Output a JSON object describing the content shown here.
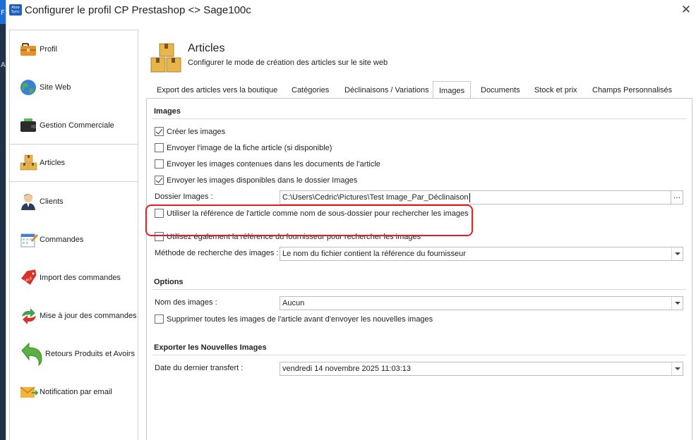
{
  "window": {
    "title": "Configurer le profil CP Prestashop <> Sage100c",
    "logo_text": "Atoo Sync",
    "close_icon": "close-icon"
  },
  "desktop": {
    "letters": [
      "F",
      "A"
    ]
  },
  "sidebar": {
    "items": [
      {
        "label": "Profil",
        "icon": "briefcase-icon"
      },
      {
        "label": "Site Web",
        "icon": "globe-icon"
      },
      {
        "label": "Gestion Commerciale",
        "icon": "wallet-icon"
      },
      {
        "label": "Articles",
        "icon": "boxes-icon",
        "active": true
      },
      {
        "label": "Clients",
        "icon": "user-icon"
      },
      {
        "label": "Commandes",
        "icon": "calendar-icon"
      },
      {
        "label": "Import des commandes",
        "icon": "sale-tag-icon"
      },
      {
        "label": "Mise à jour des commandes",
        "icon": "refresh-arrows-icon"
      },
      {
        "label": "Retours Produits et Avoirs",
        "icon": "return-arrow-icon"
      },
      {
        "label": "Notification par email",
        "icon": "email-icon"
      }
    ]
  },
  "header": {
    "title": "Articles",
    "subtitle": "Configurer le mode de création des articles sur le site web"
  },
  "tabs": [
    {
      "label": "Export des articles vers la boutique"
    },
    {
      "label": "Catégories"
    },
    {
      "label": "Déclinaisons / Variations"
    },
    {
      "label": "Images",
      "active": true
    },
    {
      "label": "Documents"
    },
    {
      "label": "Stock et prix"
    },
    {
      "label": "Champs Personnalisés"
    }
  ],
  "images_section": {
    "title": "Images",
    "create_images": {
      "label": "Créer les images",
      "checked": true
    },
    "send_article_image": {
      "label": "Envoyer l'image de la fiche article (si disponible)",
      "checked": false
    },
    "send_document_images": {
      "label": "Envoyer les images contenues dans les documents de l'article",
      "checked": false
    },
    "send_folder_images": {
      "label": "Envoyer les images disponibles dans le dossier Images",
      "checked": true
    },
    "folder_label": "Dossier Images :",
    "folder_value": "C:\\Users\\Cedric\\Pictures\\Test Image_Par_Déclinaison",
    "folder_button": "...",
    "use_article_ref": {
      "label": "Utiliser la référence de l'article comme nom de sous-dossier pour rechercher les images",
      "checked": false
    },
    "use_supplier_ref": {
      "label": "Utilisez également la référence du fournisseur pour rechercher les images",
      "checked": false
    },
    "search_method_label": "Méthode de recherche des images :",
    "search_method_value": "Le nom du fichier contient la référence du fournisseur"
  },
  "options_section": {
    "title": "Options",
    "image_name_label": "Nom des images :",
    "image_name_value": "Aucun",
    "delete_all": {
      "label": "Supprimer toutes les images de l'article avant d'envoyer les nouvelles images",
      "checked": false
    }
  },
  "export_section": {
    "title": "Exporter les Nouvelles Images",
    "last_transfer_label": "Date du dernier transfert :",
    "last_transfer_value": "vendredi 14 novembre 2025 11:03:13"
  },
  "colors": {
    "highlight": "#e31e24",
    "border": "#c8c8c8"
  }
}
